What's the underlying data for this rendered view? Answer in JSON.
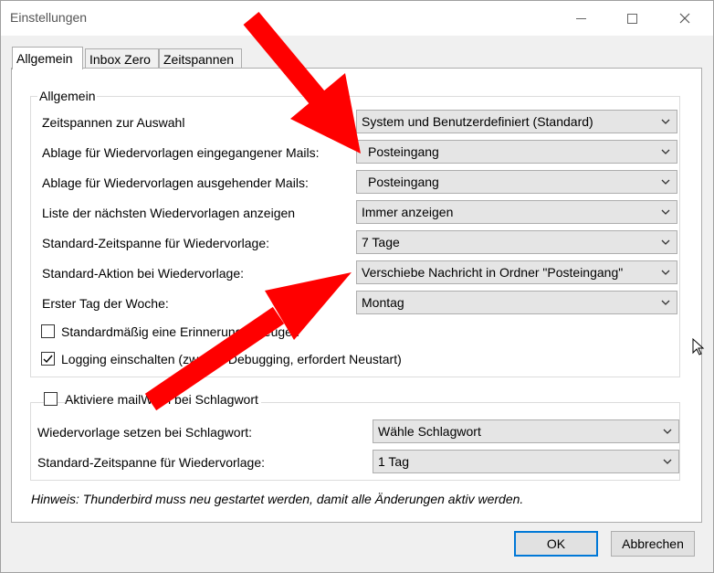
{
  "window": {
    "title": "Einstellungen",
    "minimize_icon": "minimize-icon",
    "maximize_icon": "maximize-icon",
    "close_icon": "close-icon"
  },
  "tabs": [
    {
      "label": "Allgemein",
      "active": true
    },
    {
      "label": "Inbox Zero",
      "active": false
    },
    {
      "label": "Zeitspannen",
      "active": false
    }
  ],
  "general": {
    "group_title": "Allgemein",
    "rows": [
      {
        "label": "Zeitspannen zur Auswahl",
        "value": "System und Benutzerdefiniert (Standard)"
      },
      {
        "label": "Ablage für Wiedervorlagen eingegangener Mails:",
        "value": "Posteingang"
      },
      {
        "label": "Ablage für Wiedervorlagen ausgehender Mails:",
        "value": "Posteingang"
      },
      {
        "label": "Liste der nächsten Wiedervorlagen anzeigen",
        "value": "Immer anzeigen"
      },
      {
        "label": "Standard-Zeitspanne für Wiedervorlage:",
        "value": "7 Tage"
      },
      {
        "label": "Standard-Aktion bei Wiedervorlage:",
        "value": "Verschiebe Nachricht in Ordner \"Posteingang\""
      },
      {
        "label": "Erster Tag der Woche:",
        "value": "Montag"
      }
    ],
    "checkboxes": [
      {
        "label": "Standardmäßig eine Erinnerung erzeugen",
        "checked": false
      },
      {
        "label": "Logging einschalten (zwecks Debugging, erfordert Neustart)",
        "checked": true
      }
    ]
  },
  "tagging": {
    "enable_label": "Aktiviere mailWarn bei Schlagwort",
    "enable_checked": false,
    "rows": [
      {
        "label": "Wiedervorlage setzen bei Schlagwort:",
        "value": "Wähle Schlagwort"
      },
      {
        "label": "Standard-Zeitspanne für Wiedervorlage:",
        "value": "1 Tag"
      }
    ]
  },
  "hint": "Hinweis: Thunderbird muss neu gestartet werden, damit alle Änderungen aktiv werden.",
  "buttons": {
    "ok": "OK",
    "cancel": "Abbrechen"
  },
  "colors": {
    "arrow": "#ff0000",
    "default_button_border": "#0078d7"
  }
}
